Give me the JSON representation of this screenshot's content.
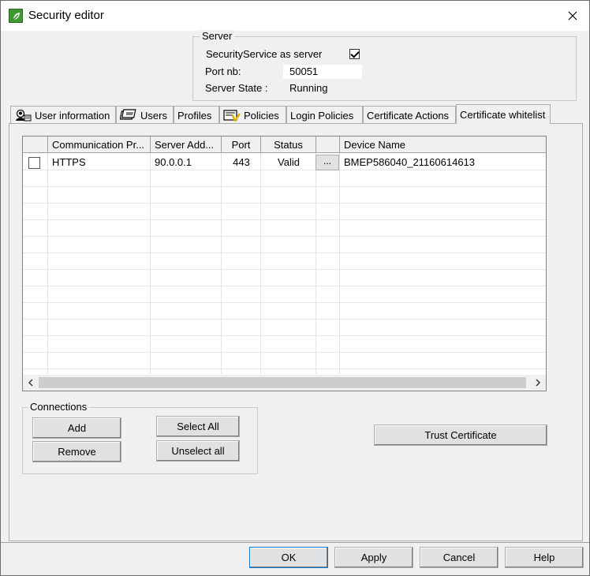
{
  "window": {
    "title": "Security editor"
  },
  "server": {
    "legend": "Server",
    "as_server_label": "SecurityService as server",
    "as_server_checked": true,
    "port_label": "Port nb:",
    "port_value": "50051",
    "state_label": "Server State :",
    "state_value": "Running"
  },
  "tabs": [
    {
      "label": "User information",
      "icon": "user-info-icon",
      "active": false
    },
    {
      "label": "Users",
      "icon": "users-icon",
      "active": false
    },
    {
      "label": "Profiles",
      "icon": "",
      "active": false
    },
    {
      "label": "Policies",
      "icon": "policies-icon",
      "active": false
    },
    {
      "label": "Login Policies",
      "icon": "",
      "active": false
    },
    {
      "label": "Certificate Actions",
      "icon": "",
      "active": false
    },
    {
      "label": "Certificate whitelist",
      "icon": "",
      "active": true
    }
  ],
  "table": {
    "columns": [
      "",
      "Communication Pr...",
      "Server Add...",
      "Port",
      "Status",
      "",
      "Device Name"
    ],
    "rows": [
      {
        "checked": false,
        "protocol": "HTTPS",
        "server_address": "90.0.0.1",
        "port": "443",
        "status": "Valid",
        "action": "...",
        "device_name": "BMEP586040_21160614613"
      }
    ]
  },
  "connections": {
    "legend": "Connections",
    "add_label": "Add",
    "remove_label": "Remove",
    "select_all_label": "Select All",
    "unselect_all_label": "Unselect all"
  },
  "trust_label": "Trust Certificate",
  "footer": {
    "ok_label": "OK",
    "apply_label": "Apply",
    "cancel_label": "Cancel",
    "help_label": "Help"
  },
  "colors": {
    "window_bg": "#f0f0f0",
    "titlebar_bg": "#ffffff",
    "app_icon": "#3c9a2f"
  }
}
